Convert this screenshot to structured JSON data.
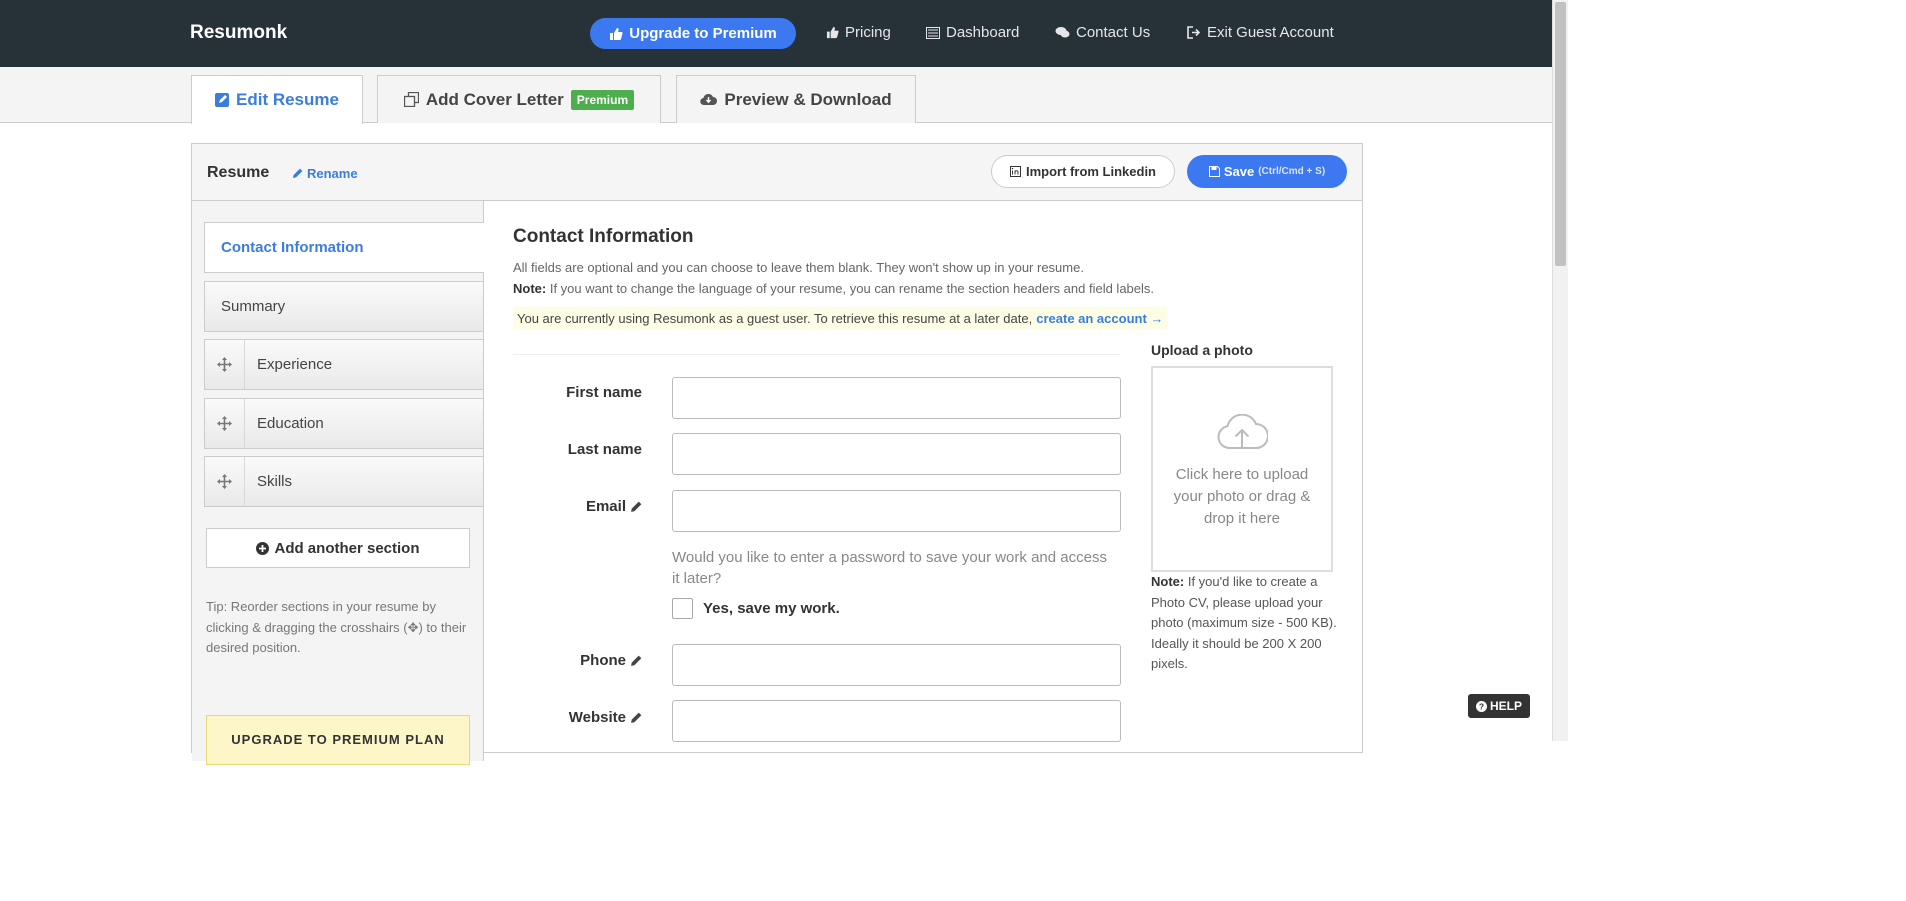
{
  "nav": {
    "brand": "Resumonk",
    "upgrade_label": "Upgrade to Premium",
    "pricing": "Pricing",
    "dashboard": "Dashboard",
    "contact": "Contact Us",
    "exit": "Exit Guest Account"
  },
  "tabs": {
    "edit": "Edit Resume",
    "cover": "Add Cover Letter",
    "cover_badge": "Premium",
    "preview": "Preview & Download"
  },
  "panel": {
    "title": "Resume",
    "rename": "Rename",
    "import": "Import from Linkedin",
    "save": "Save",
    "save_shortcut": "(Ctrl/Cmd + S)"
  },
  "sidebar": {
    "items": [
      {
        "label": "Contact Information"
      },
      {
        "label": "Summary"
      },
      {
        "label": "Experience"
      },
      {
        "label": "Education"
      },
      {
        "label": "Skills"
      }
    ],
    "add_section": "Add another section",
    "tip": "Tip: Reorder sections in your resume by clicking & dragging the crosshairs (✥) to their desired position.",
    "upgrade_box": "UPGRADE TO PREMIUM PLAN"
  },
  "content": {
    "heading": "Contact Information",
    "desc1": "All fields are optional and you can choose to leave them blank. They won't show up in your resume.",
    "note_label": "Note:",
    "desc2": "If you want to change the language of your resume, you can rename the section headers and field labels.",
    "guest_text": "You are currently using Resumonk as a guest user. To retrieve this resume at a later date,",
    "guest_link": "create an account →",
    "fields": {
      "first_name": "First name",
      "last_name": "Last name",
      "email": "Email",
      "phone": "Phone",
      "website": "Website"
    },
    "password_question": "Would you like to enter a password to save your work and access it later?",
    "save_work": "Yes, save my work."
  },
  "photo": {
    "title": "Upload a photo",
    "drop_text": "Click here to upload your photo or drag & drop it here",
    "note_label": "Note:",
    "note": "If you'd like to create a Photo CV, please upload your photo (maximum size - 500 KB). Ideally it should be 200 X 200 pixels."
  },
  "help": "HELP",
  "colors": {
    "navbar": "#263238",
    "accent": "#3c78f0",
    "link": "#3b7ddd",
    "premium_badge": "#4cae4c"
  }
}
